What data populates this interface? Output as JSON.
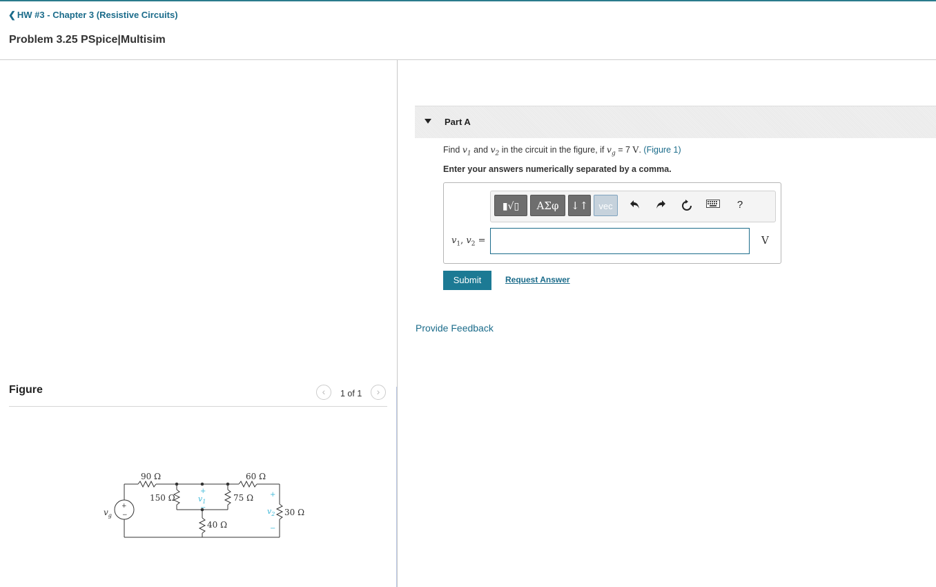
{
  "header": {
    "back_link": "HW #3 - Chapter 3 (Resistive Circuits)",
    "problem_title": "Problem 3.25 PSpice|Multisim"
  },
  "part": {
    "title": "Part A",
    "question": {
      "find": "Find",
      "v1": "v",
      "v1_sub": "1",
      "and": "and",
      "v2": "v",
      "v2_sub": "2",
      "in_circuit": "in the circuit in the figure, if",
      "vg": "v",
      "vg_sub": "g",
      "equals_value": "= 7",
      "unit": "V",
      "period": ".",
      "figure_link": "(Figure 1)"
    },
    "instruction": "Enter your answers numerically separated by a comma.",
    "toolbar": {
      "templates_label": "▮√▯",
      "greek_label": "ΑΣφ",
      "arrows_label": "↓↑",
      "vec_label": "vec",
      "help_label": "?",
      "icons": [
        "undo-icon",
        "redo-icon",
        "reset-icon",
        "keyboard-icon",
        "help-icon"
      ]
    },
    "answer_label": {
      "v1": "v",
      "v1_sub": "1",
      "sep": ", ",
      "v2": "v",
      "v2_sub": "2",
      "eq": " ="
    },
    "answer_value": "",
    "unit": "V",
    "submit_label": "Submit",
    "request_answer_label": "Request Answer",
    "feedback_label": "Provide Feedback"
  },
  "figure": {
    "title": "Figure",
    "counter": "1 of 1",
    "prev_icon": "chevron-left-icon",
    "next_icon": "chevron-right-icon",
    "labels": {
      "r90": "90 Ω",
      "r60": "60 Ω",
      "r150": "150 Ω",
      "r75": "75 Ω",
      "r40": "40 Ω",
      "r30": "30 Ω",
      "vg": "v",
      "vg_sub": "g",
      "v1": "v",
      "v1_sub": "1",
      "v2": "v",
      "v2_sub": "2",
      "plus": "+",
      "minus": "−"
    }
  },
  "colors": {
    "accent": "#1c7a94",
    "link": "#1a6b8a",
    "topbar": "#2a7b8c",
    "circuit_label": "#3fb8d8"
  }
}
